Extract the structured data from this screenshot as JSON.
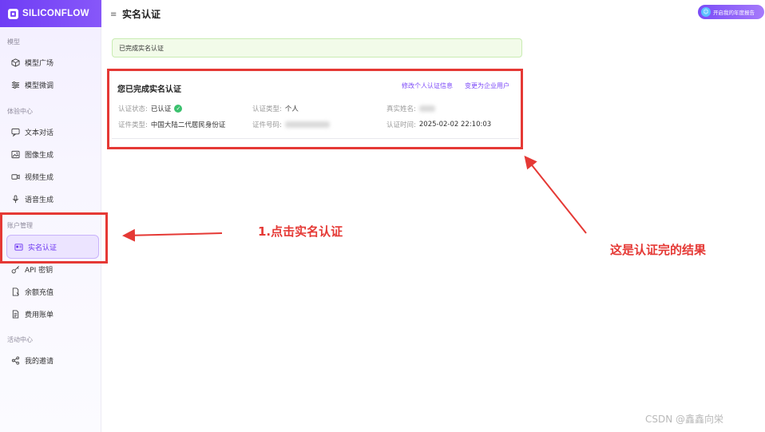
{
  "brand": {
    "name": "SILICONFLOW"
  },
  "sidebar": {
    "sections": [
      {
        "title": "模型",
        "items": [
          {
            "label": "模型广场",
            "icon": "cube-icon"
          },
          {
            "label": "模型微调",
            "icon": "sliders-icon"
          }
        ]
      },
      {
        "title": "体验中心",
        "items": [
          {
            "label": "文本对话",
            "icon": "chat-icon"
          },
          {
            "label": "图像生成",
            "icon": "image-icon"
          },
          {
            "label": "视频生成",
            "icon": "video-icon"
          },
          {
            "label": "语音生成",
            "icon": "mic-icon"
          }
        ]
      },
      {
        "title": "账户管理",
        "items": [
          {
            "label": "实名认证",
            "icon": "id-card-icon"
          },
          {
            "label": "API 密钥",
            "icon": "key-icon"
          },
          {
            "label": "余额充值",
            "icon": "wallet-icon"
          },
          {
            "label": "费用账单",
            "icon": "bill-icon"
          }
        ]
      },
      {
        "title": "活动中心",
        "items": [
          {
            "label": "我的邀请",
            "icon": "share-icon"
          }
        ]
      }
    ]
  },
  "header": {
    "title": "实名认证",
    "report_button": "开启我的年度报告"
  },
  "notice": "已完成实名认证",
  "card": {
    "title": "您已完成实名认证",
    "link_modify": "修改个人认证信息",
    "link_enterprise": "变更为企业用户",
    "fields": {
      "status_label": "认证状态:",
      "status_value": "已认证",
      "type_label": "认证类型:",
      "type_value": "个人",
      "name_label": "真实姓名:",
      "idtype_label": "证件类型:",
      "idtype_value": "中国大陆二代居民身份证",
      "idno_label": "证件号码:",
      "time_label": "认证时间:",
      "time_value": "2025-02-02 22:10:03"
    }
  },
  "annotations": {
    "step": "1.点击实名认证",
    "result": "这是认证完的结果"
  },
  "watermark": "CSDN @鑫鑫向栄",
  "colors": {
    "accent": "#7b48f8",
    "annotation_red": "#e53935",
    "success": "#3bc16e"
  }
}
